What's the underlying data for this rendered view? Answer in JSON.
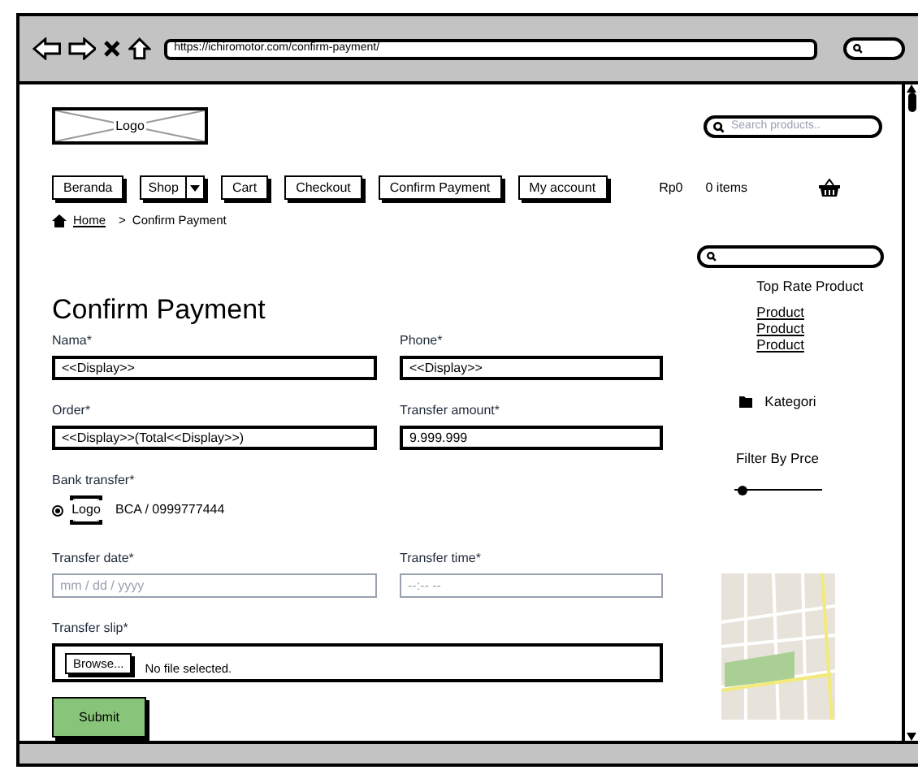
{
  "browser": {
    "url": "https://ichiromotor.com/confirm-payment/"
  },
  "header": {
    "logo": "Logo",
    "search_placeholder": "Search products..",
    "cart_total": "Rp0",
    "cart_items": "0 items"
  },
  "nav": [
    {
      "label": "Beranda",
      "kind": "plain"
    },
    {
      "label": "Shop",
      "kind": "dropdown"
    },
    {
      "label": "Cart",
      "kind": "plain"
    },
    {
      "label": "Checkout",
      "kind": "plain"
    },
    {
      "label": "Confirm Payment",
      "kind": "plain"
    },
    {
      "label": "My account",
      "kind": "plain"
    }
  ],
  "breadcrumb": {
    "home": "Home",
    "separator": ">",
    "current": "Confirm Payment"
  },
  "form": {
    "title": "Confirm Payment",
    "rows": [
      [
        {
          "label": "Nama*",
          "value": "<<Display>>"
        },
        {
          "label": "Phone*",
          "value": "<<Display>>"
        }
      ],
      [
        {
          "label": "Order*",
          "value": "<<Display>>(Total<<Display>>)"
        },
        {
          "label": "Transfer amount*",
          "value": "9.999.999"
        }
      ]
    ],
    "bank_label": "Bank transfer*",
    "bank_options": [
      {
        "logo": "Logo",
        "text": "BCA / 0999777444",
        "selected": true
      }
    ],
    "date_label": "Transfer date*",
    "date_placeholder": "mm / dd / yyyy",
    "time_label": "Transfer time*",
    "time_placeholder": "--:-- --",
    "slip_label": "Transfer slip*",
    "browse": "Browse...",
    "no_file": "No file selected.",
    "submit": "Submit"
  },
  "sidebar": {
    "top_rate_title": "Top Rate Product",
    "products": [
      "Product",
      "Product",
      "Product"
    ],
    "category": "Kategori",
    "filter_title": "Filter By Prce",
    "price_slider": {
      "level": 0.1
    }
  }
}
